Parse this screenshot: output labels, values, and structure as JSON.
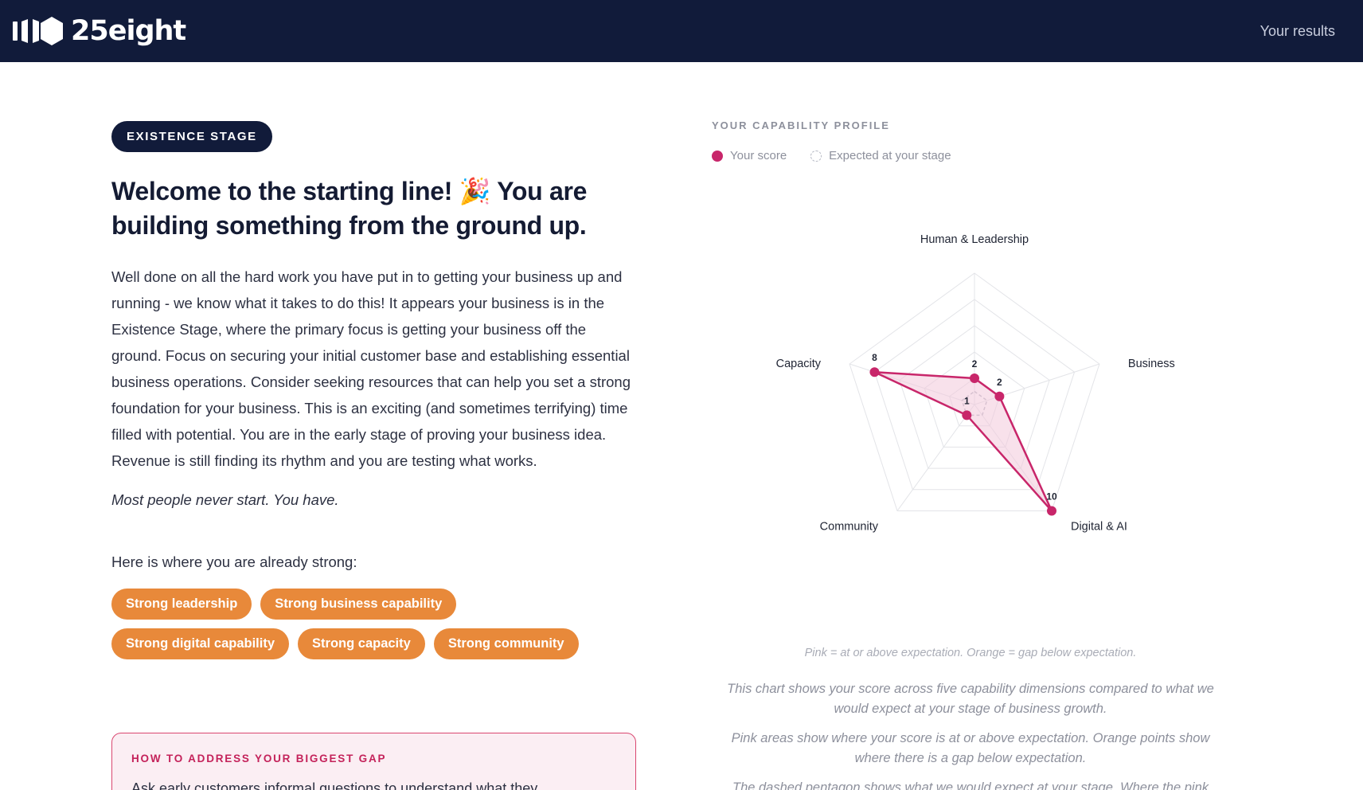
{
  "header": {
    "brand_name": "25eight",
    "nav_link": "Your results"
  },
  "stage": {
    "pill": "EXISTENCE STAGE",
    "headline": "Welcome to the starting line! 🎉 You are building something from the ground up.",
    "body": "Well done on all the hard work you have put in to getting your business up and running - we know what it takes to do this! It appears your business is in the Existence Stage, where the primary focus is getting your business off the ground. Focus on securing your initial customer base and establishing essential business operations. Consider seeking resources that can help you set a strong foundation for your business. This is an exciting (and sometimes terrifying) time filled with potential. You are in the early stage of proving your business idea. Revenue is still finding its rhythm and you are testing what works.",
    "tagline": "Most people never start. You have.",
    "strengths_intro": "Here is where you are already strong:",
    "strengths": [
      "Strong leadership",
      "Strong business capability",
      "Strong digital capability",
      "Strong capacity",
      "Strong community"
    ]
  },
  "gap_card": {
    "title": "HOW TO ADDRESS YOUR BIGGEST GAP",
    "text": "Ask early customers informal questions to understand what they"
  },
  "profile": {
    "label": "YOUR CAPABILITY PROFILE",
    "legend_score": "Your score",
    "legend_expected": "Expected at your stage",
    "legend_note": "Pink = at or above expectation. Orange = gap below expectation.",
    "notes": [
      "This chart shows your score across five capability dimensions compared to what we would expect at your stage of business growth.",
      "Pink areas show where your score is at or above expectation. Orange points show where there is a gap below expectation.",
      "The dashed pentagon shows what we would expect at your stage. Where the pink"
    ]
  },
  "chart_data": {
    "type": "radar",
    "axes": [
      "Human & Leadership",
      "Business",
      "Digital & AI",
      "Community",
      "Capacity"
    ],
    "series": [
      {
        "name": "Your score",
        "values": [
          2,
          2,
          10,
          1,
          8
        ]
      },
      {
        "name": "Expected at your stage",
        "values": [
          1,
          1,
          1,
          1,
          1
        ]
      }
    ],
    "rlim": [
      0,
      10
    ],
    "rings": 5,
    "colors": {
      "score": "#c8266a",
      "score_fill": "#f3c8da",
      "grid": "#e3e4e8",
      "expected": "#b6b9c4"
    }
  }
}
